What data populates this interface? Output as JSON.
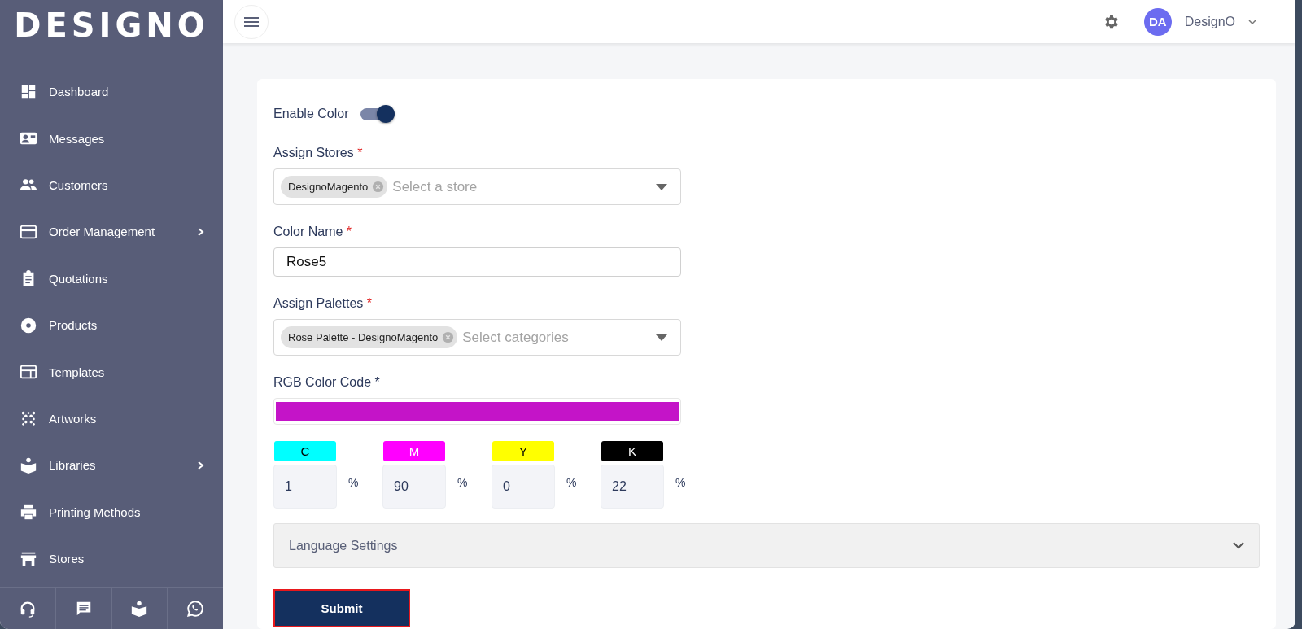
{
  "sidebar": {
    "logo": "DESIGNO",
    "items": [
      {
        "label": "Dashboard",
        "submenu": false
      },
      {
        "label": "Messages",
        "submenu": false
      },
      {
        "label": "Customers",
        "submenu": false
      },
      {
        "label": "Order Management",
        "submenu": true
      },
      {
        "label": "Quotations",
        "submenu": false
      },
      {
        "label": "Products",
        "submenu": false
      },
      {
        "label": "Templates",
        "submenu": false
      },
      {
        "label": "Artworks",
        "submenu": false
      },
      {
        "label": "Libraries",
        "submenu": true
      },
      {
        "label": "Printing Methods",
        "submenu": false
      },
      {
        "label": "Stores",
        "submenu": false
      }
    ]
  },
  "header": {
    "user": {
      "initials": "DA",
      "name": "DesignO"
    }
  },
  "form": {
    "toggle": {
      "label": "Enable Color",
      "on": true
    },
    "fields": [
      {
        "kind": "multiselect",
        "label": "Assign Stores",
        "required_mark": "*",
        "tags": [
          "DesignoMagento"
        ],
        "placeholder": "Select a store"
      },
      {
        "kind": "text",
        "label": "Color Name",
        "required_mark": "*",
        "value": "Rose5"
      },
      {
        "kind": "multiselect",
        "label": "Assign Palettes",
        "required_mark": "*",
        "tags": [
          "Rose Palette - DesignoMagento"
        ],
        "placeholder": "Select categories"
      },
      {
        "kind": "color",
        "label": "RGB Color Code *",
        "color": "#c414c8"
      },
      {
        "kind": "cmyk",
        "channels": [
          {
            "label": "C",
            "color": "#00ffff",
            "value": "1",
            "unit": "%"
          },
          {
            "label": "M",
            "color": "#ff00ff",
            "value": "90",
            "unit": "%"
          },
          {
            "label": "Y",
            "color": "#ffff00",
            "value": "0",
            "unit": "%"
          },
          {
            "label": "K",
            "color": "#000000",
            "value": "22",
            "unit": "%"
          }
        ]
      }
    ],
    "accordion": {
      "label": "Language Settings",
      "expanded": false
    },
    "submit": "Submit"
  }
}
